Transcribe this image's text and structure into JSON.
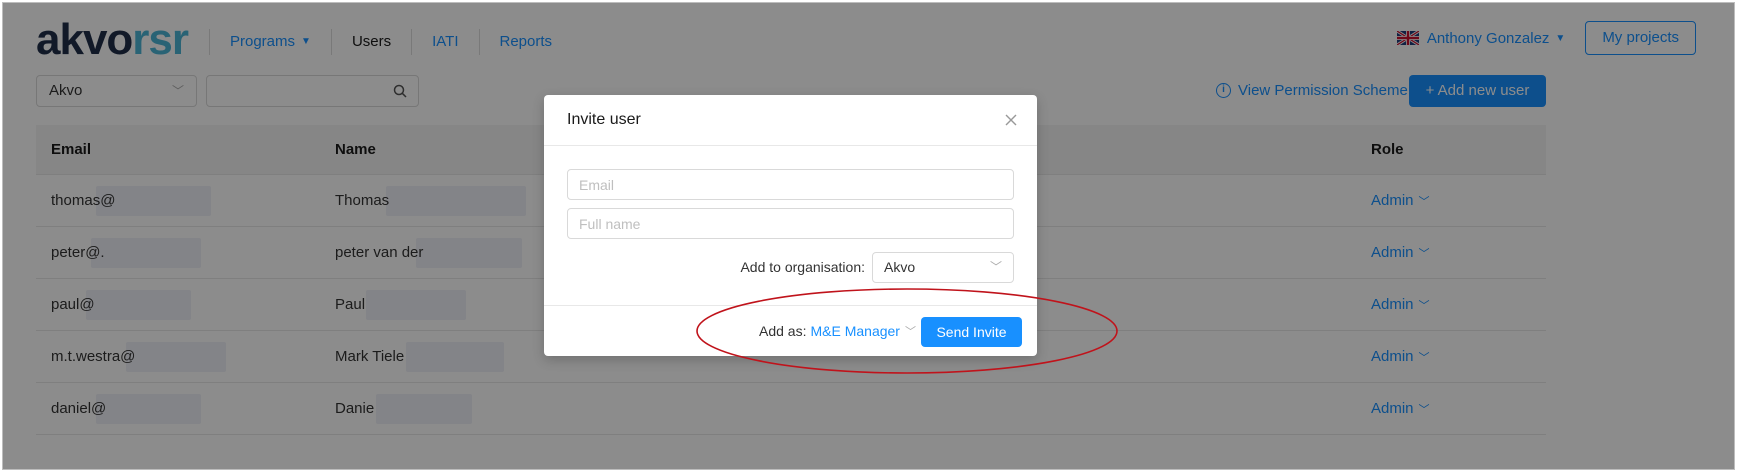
{
  "app": {
    "logo_primary": "akvo",
    "logo_secondary": "rsr"
  },
  "nav": {
    "items": [
      {
        "label": "Programs",
        "has_dropdown": true,
        "active": false
      },
      {
        "label": "Users",
        "has_dropdown": false,
        "active": true
      },
      {
        "label": "IATI",
        "has_dropdown": false,
        "active": false
      },
      {
        "label": "Reports",
        "has_dropdown": false,
        "active": false
      }
    ],
    "user_name": "Anthony Gonzalez",
    "my_projects_label": "My projects"
  },
  "toolbar": {
    "org_filter_value": "Akvo",
    "search_placeholder": "",
    "permission_link_label": "View Permission Scheme",
    "add_user_label": "+ Add new user"
  },
  "table": {
    "headers": {
      "email": "Email",
      "name": "Name",
      "role": "Role"
    },
    "rows": [
      {
        "email": "thomas@",
        "name": "Thomas",
        "role": "Admin"
      },
      {
        "email": "peter@.",
        "name": "peter van der",
        "role": "Admin"
      },
      {
        "email": "paul@",
        "name": "Paul",
        "role": "Admin"
      },
      {
        "email": "m.t.westra@",
        "name": "Mark Tiele",
        "role": "Admin"
      },
      {
        "email": "daniel@",
        "name": "Danie",
        "role": "Admin"
      }
    ]
  },
  "modal": {
    "title": "Invite user",
    "email_placeholder": "Email",
    "fullname_placeholder": "Full name",
    "org_label": "Add to organisation:",
    "org_value": "Akvo",
    "add_as_label": "Add as:",
    "role_value": "M&E Manager",
    "send_label": "Send Invite"
  },
  "colors": {
    "accent": "#1890ff",
    "logo_dark": "#1f2f4a",
    "logo_light": "#4bb4d6",
    "highlight": "#c0131b"
  }
}
